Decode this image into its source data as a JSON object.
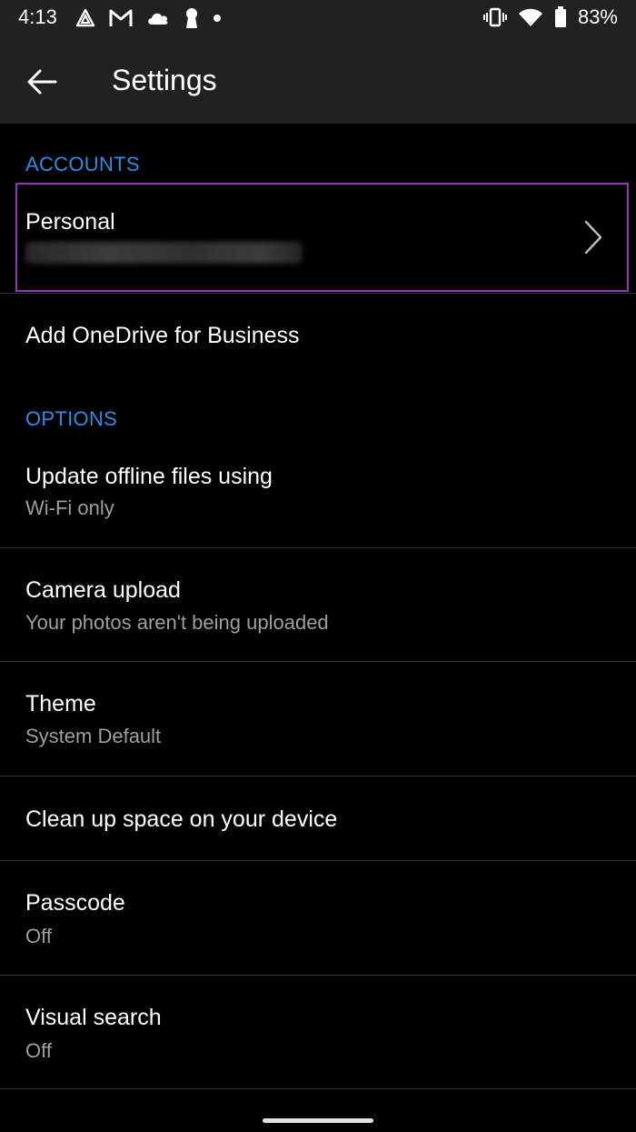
{
  "status_bar": {
    "time": "4:13",
    "battery_percent": "83%",
    "left_icons": [
      "navigation-icon",
      "gmail-icon",
      "cloud-icon",
      "keyhole-icon",
      "dot-icon"
    ],
    "right_icons": [
      "vibrate-icon",
      "wifi-icon",
      "battery-icon"
    ]
  },
  "app_bar": {
    "title": "Settings",
    "back_icon": "arrow-left-icon"
  },
  "sections": {
    "accounts_header": "ACCOUNTS",
    "options_header": "OPTIONS"
  },
  "accounts": {
    "personal_label": "Personal",
    "add_business_label": "Add OneDrive for Business"
  },
  "options": [
    {
      "title": "Update offline files using",
      "subtitle": "Wi-Fi only"
    },
    {
      "title": "Camera upload",
      "subtitle": "Your photos aren't being uploaded"
    },
    {
      "title": "Theme",
      "subtitle": "System Default"
    },
    {
      "title": "Clean up space on your device",
      "subtitle": ""
    },
    {
      "title": "Passcode",
      "subtitle": "Off"
    },
    {
      "title": "Visual search",
      "subtitle": "Off"
    }
  ],
  "colors": {
    "accent_blue": "#2b8de8",
    "highlight_purple": "#9b2fbf",
    "background": "#000000",
    "bar_background": "#212121"
  }
}
